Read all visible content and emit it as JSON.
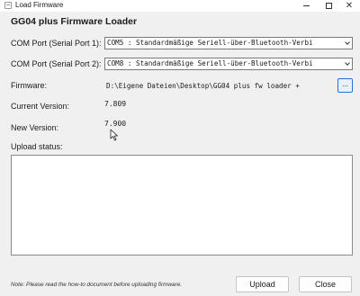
{
  "window": {
    "title": "Load Firmware",
    "controls": {
      "minimize": "minimize-icon",
      "maximize": "maximize-icon",
      "close": "close-icon"
    }
  },
  "heading": "GG04 plus Firmware Loader",
  "com_port_1": {
    "label": "COM Port (Serial Port 1):",
    "selected": "COM5 : Standardmäßige Seriell-über-Bluetooth-Verbi"
  },
  "com_port_2": {
    "label": "COM Port (Serial Port 2):",
    "selected": "COM8 : Standardmäßige Seriell-über-Bluetooth-Verbi"
  },
  "firmware": {
    "label": "Firmware:",
    "path": "D:\\Eigene Dateien\\Desktop\\GG04 plus fw loader + ",
    "browse_label": "..."
  },
  "current_version": {
    "label": "Current Version:",
    "value": "7.809"
  },
  "new_version": {
    "label": "New Version:",
    "value": "7.900"
  },
  "upload_status": {
    "label": "Upload status:",
    "text": ""
  },
  "note": "Note:  Please read the how-to document before uploading firmware.",
  "buttons": {
    "upload": "Upload",
    "close": "Close"
  },
  "colors": {
    "accent": "#2a6fd6",
    "background": "#f0f0f0"
  }
}
